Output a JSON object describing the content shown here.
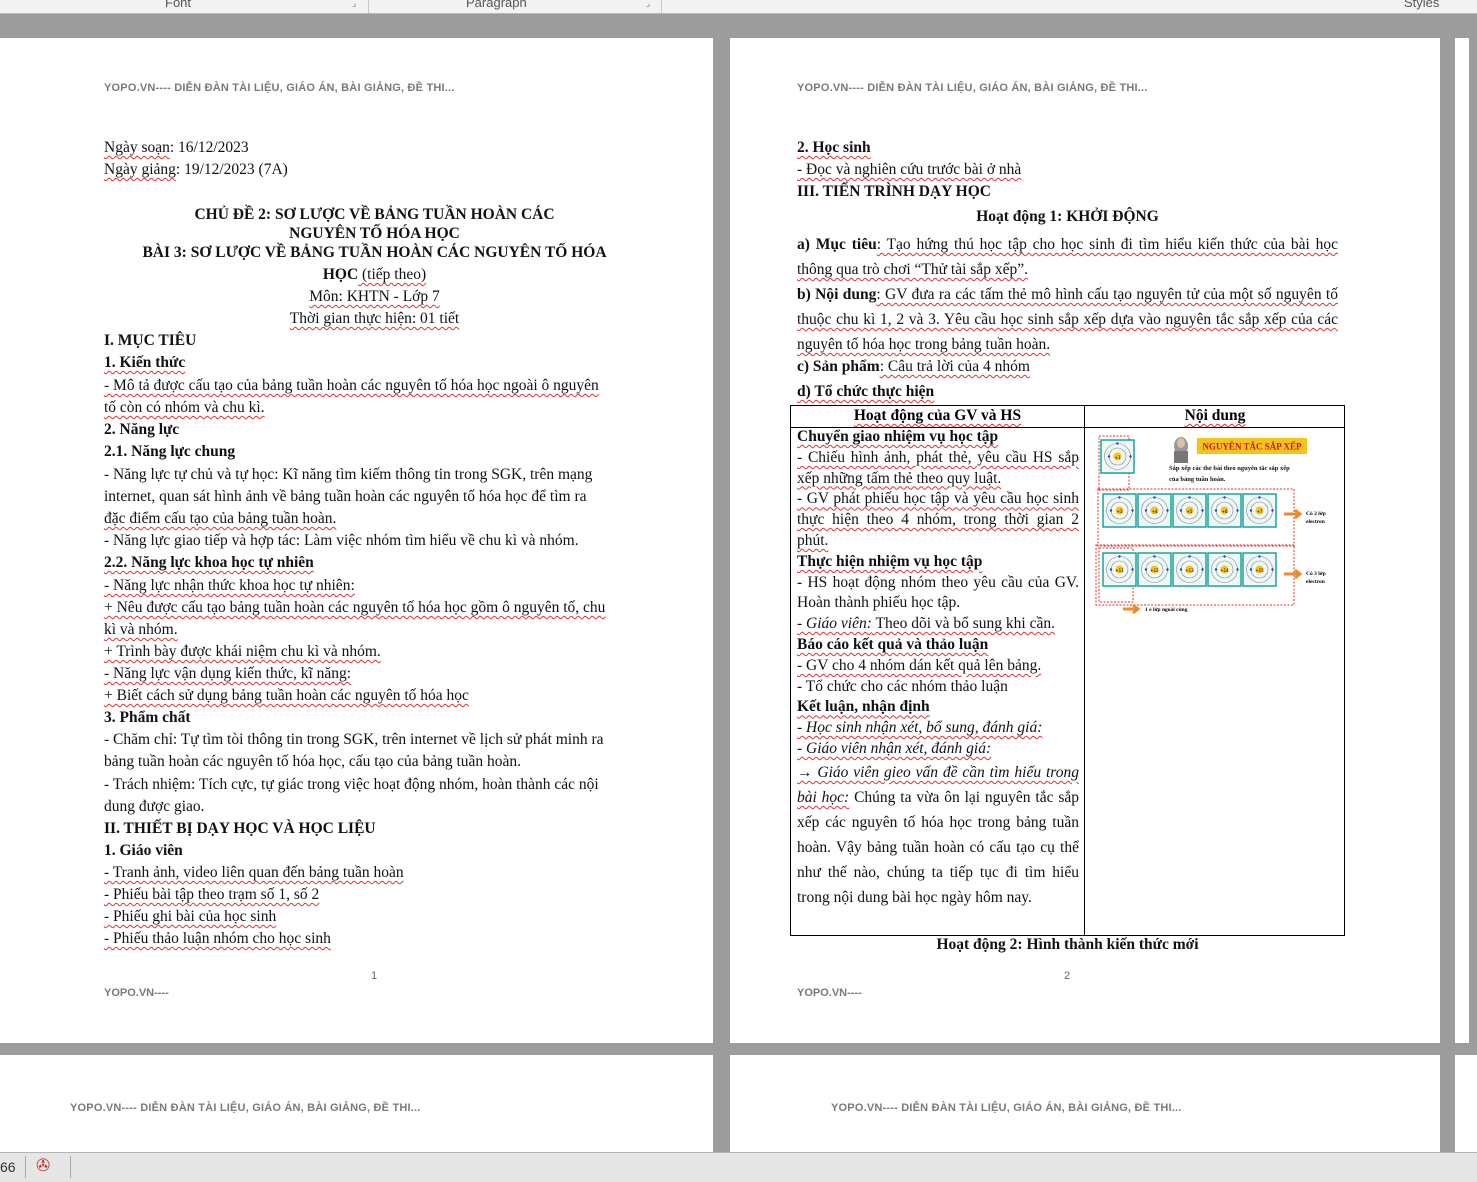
{
  "ribbon": {
    "font": "Font",
    "paragraph": "Paragraph",
    "styles": "Styles"
  },
  "header_text": "YOPO.VN---- DIỄN ĐÀN TÀI LIỆU, GIÁO ÁN, BÀI GIẢNG, ĐỀ THI...",
  "footer_text": "YOPO.VN----",
  "page1": {
    "page_number": "1",
    "ngay_soan_label": "Ngày soạn",
    "ngay_soan_value": ": 16/12/2023",
    "ngay_giang_label": "Ngày giảng",
    "ngay_giang_value": ": 19/12/2023 (7A)",
    "title_1": "CHỦ ĐỀ 2: SƠ LƯỢC VỀ BẢNG TUẦN HOÀN CÁC",
    "title_2": "NGUYÊN TỐ HÓA HỌC",
    "title_3": "BÀI 3: SƠ LƯỢC VỀ BẢNG TUẦN HOÀN CÁC NGUYÊN TỐ HÓA",
    "title_4a": "HỌC",
    "title_4b": " (tiếp theo)",
    "mon": "Môn: KHTN - Lớp 7",
    "thoi_gian": "Thời gian thực hiện: 01 tiết",
    "sec_I": "I. MỤC TIÊU",
    "sec_1": "1. Kiến thức",
    "kt_1": "- Mô tả được cấu tạo của bảng tuần hoàn các nguyên tố hóa học ngoài ô nguyên",
    "kt_2": "tố còn có nhóm và chu kì.",
    "sec_2": "2. Năng lực",
    "sec_21": "2.1. Năng lực chung",
    "nl_1": "- Năng lực tự chủ và tự học: Kĩ năng tìm kiếm thông tin trong SGK, trên mạng",
    "nl_2": "internet, quan sát hình ảnh về bảng tuần hoàn các nguyên tố hóa học để tìm ra",
    "nl_3": "đặc điểm cấu tạo của bảng tuần hoàn.",
    "nl_4": "- Năng lực giao tiếp và hợp tác: Làm việc nhóm tìm hiểu về chu kì và nhóm.",
    "sec_22": "2.2. Năng lực khoa học tự nhiên",
    "kh_1": "- Năng lực nhận thức khoa học tự nhiên:",
    "kh_2": "+ Nêu được cấu tạo bảng tuần hoàn các nguyên tố hóa học gồm ô nguyên tố, chu",
    "kh_3": "kì và nhóm.",
    "kh_4": "+ Trình bày được khái niệm chu kì và nhóm.",
    "kh_5": "- Năng lực vận dụng kiến thức, kĩ năng:",
    "kh_6": "+ Biết cách sử dụng bảng tuần hoàn các nguyên tố hóa học",
    "sec_3": "3. Phẩm chất",
    "pc_1": "- Chăm chỉ: Tự tìm tòi thông tin trong SGK, trên internet về lịch sử phát minh ra",
    "pc_2": "bảng tuần hoàn các nguyên tố hóa  học, cấu tạo của bảng tuần hoàn.",
    "pc_3": "- Trách nhiệm: Tích cực, tự giác trong việc hoạt động nhóm, hoàn thành các nội",
    "pc_4": "dung được giao.",
    "sec_II": "II. THIẾT BỊ DẠY HỌC VÀ HỌC LIỆU",
    "sec_gv": "1. Giáo viên",
    "gv_1": "- Tranh ảnh, video liên quan đến bảng tuần hoàn",
    "gv_2": "- Phiếu bài tập theo trạm số 1, số 2",
    "gv_3": "- Phiếu ghi bài của học sinh",
    "gv_4": "- Phiếu thảo luận nhóm cho học sinh"
  },
  "page2": {
    "page_number": "2",
    "hs_title": "2. Học sinh",
    "hs_1": "- Đọc và nghiên cứu trước bài ở nhà",
    "sec_III": "III. TIẾN TRÌNH DẠY HỌC",
    "hd1": "Hoạt động 1: KHỞI ĐỘNG",
    "a_label": "a) Mục tiêu",
    "a_text": ": Tạo hứng thú học tập cho học sinh đi tìm hiểu kiến thức của bài học thông qua trò chơi “Thử tài sắp xếp”.",
    "b_label": "b) Nội dung",
    "b_text": ": GV đưa ra các tấm thẻ mô hình cấu tạo nguyên tử của một số nguyên tố thuộc chu kì 1, 2 và 3. Yêu cầu học sinh sắp xếp dựa vào nguyên tắc sắp xếp của các nguyên tố hóa học trong bảng tuần hoàn.",
    "c_label": "c) Sản phẩm",
    "c_text": ": Câu trả lời của 4 nhóm",
    "d_label": "d) Tổ chức thực hiện",
    "table": {
      "col1": "Hoạt động của GV và HS",
      "col2": "Nội dung",
      "s1_title": "Chuyển giao nhiệm vụ học tập",
      "s1_1": "- Chiếu hình ảnh, phát thẻ, yêu cầu HS sắp xếp những tấm thẻ theo quy luật.",
      "s1_2": "- GV phát phiếu học tập và yêu cầu học sinh thực hiện theo 4 nhóm, trong thời gian 2 phút.",
      "s2_title": "Thực hiện nhiệm vụ học tập",
      "s2_1": "- HS hoạt động nhóm theo yêu cầu của GV. Hoàn thành phiếu học tập.",
      "s2_2a": "- Giáo viên:",
      "s2_2b": " Theo dõi và bổ sung khi cần.",
      "s3_title": "Báo cáo kết quả và thảo luận",
      "s3_1": "- GV cho 4 nhóm dán kết quả lên bảng.",
      "s3_2": "- Tổ chức cho các nhóm thảo luận",
      "s4_title": "Kết luận, nhận định",
      "s4_1": "- Học sinh nhận xét, bổ sung, đánh giá:",
      "s4_2": "- Giáo viên nhận xét, đánh giá:",
      "s4_3a": "→ Giáo viên gieo vấn đề cần tìm hiểu trong bài học:",
      "s4_3b": " Chúng ta vừa ôn lại nguyên tắc sắp xếp các nguyên tố hóa học trong bảng tuần hoàn. Vậy bảng tuần hoàn có cấu tạo cụ thể như thế nào, chúng ta tiếp tục đi tìm hiểu trong nội dung bài học ngày hôm nay."
    },
    "diagram": {
      "banner": "NGUYÊN TẮC SẮP XẾP",
      "caption_1": "Sắp xếp các thẻ bài theo nguyên tắc sắp xếp",
      "caption_2": "của bảng tuần hoàn.",
      "label_row2_a": "Có 2 lớp",
      "label_row2_b": "electron",
      "label_row3_a": "Có 3 lớp",
      "label_row3_b": "electron",
      "bottom_label": "1 e lớp ngoài cùng",
      "row1": [
        "+1"
      ],
      "row2": [
        "+3",
        "+4",
        "+5",
        "+6",
        "+7"
      ],
      "row3": [
        "+11",
        "+12",
        "+13",
        "+14",
        "+15"
      ]
    },
    "hd2": "Hoạt động 2: Hình thành kiến thức mới"
  },
  "status_bar": {
    "zoom_fragment": "66"
  },
  "colors": {
    "header_grey": "#7a7a7a",
    "banner_yellow": "#f6c21c",
    "cell_teal": "#1aa39b",
    "arrow_orange": "#ef8a2b",
    "dash_red": "#e0302a"
  }
}
